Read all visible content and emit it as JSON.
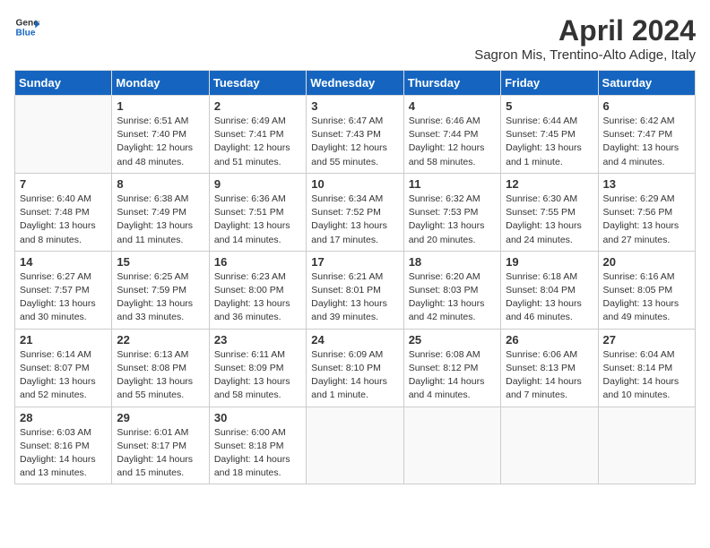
{
  "header": {
    "logo_line1": "General",
    "logo_line2": "Blue",
    "month_title": "April 2024",
    "subtitle": "Sagron Mis, Trentino-Alto Adige, Italy"
  },
  "days_of_week": [
    "Sunday",
    "Monday",
    "Tuesday",
    "Wednesday",
    "Thursday",
    "Friday",
    "Saturday"
  ],
  "weeks": [
    [
      {
        "day": "",
        "info": ""
      },
      {
        "day": "1",
        "info": "Sunrise: 6:51 AM\nSunset: 7:40 PM\nDaylight: 12 hours\nand 48 minutes."
      },
      {
        "day": "2",
        "info": "Sunrise: 6:49 AM\nSunset: 7:41 PM\nDaylight: 12 hours\nand 51 minutes."
      },
      {
        "day": "3",
        "info": "Sunrise: 6:47 AM\nSunset: 7:43 PM\nDaylight: 12 hours\nand 55 minutes."
      },
      {
        "day": "4",
        "info": "Sunrise: 6:46 AM\nSunset: 7:44 PM\nDaylight: 12 hours\nand 58 minutes."
      },
      {
        "day": "5",
        "info": "Sunrise: 6:44 AM\nSunset: 7:45 PM\nDaylight: 13 hours\nand 1 minute."
      },
      {
        "day": "6",
        "info": "Sunrise: 6:42 AM\nSunset: 7:47 PM\nDaylight: 13 hours\nand 4 minutes."
      }
    ],
    [
      {
        "day": "7",
        "info": "Sunrise: 6:40 AM\nSunset: 7:48 PM\nDaylight: 13 hours\nand 8 minutes."
      },
      {
        "day": "8",
        "info": "Sunrise: 6:38 AM\nSunset: 7:49 PM\nDaylight: 13 hours\nand 11 minutes."
      },
      {
        "day": "9",
        "info": "Sunrise: 6:36 AM\nSunset: 7:51 PM\nDaylight: 13 hours\nand 14 minutes."
      },
      {
        "day": "10",
        "info": "Sunrise: 6:34 AM\nSunset: 7:52 PM\nDaylight: 13 hours\nand 17 minutes."
      },
      {
        "day": "11",
        "info": "Sunrise: 6:32 AM\nSunset: 7:53 PM\nDaylight: 13 hours\nand 20 minutes."
      },
      {
        "day": "12",
        "info": "Sunrise: 6:30 AM\nSunset: 7:55 PM\nDaylight: 13 hours\nand 24 minutes."
      },
      {
        "day": "13",
        "info": "Sunrise: 6:29 AM\nSunset: 7:56 PM\nDaylight: 13 hours\nand 27 minutes."
      }
    ],
    [
      {
        "day": "14",
        "info": "Sunrise: 6:27 AM\nSunset: 7:57 PM\nDaylight: 13 hours\nand 30 minutes."
      },
      {
        "day": "15",
        "info": "Sunrise: 6:25 AM\nSunset: 7:59 PM\nDaylight: 13 hours\nand 33 minutes."
      },
      {
        "day": "16",
        "info": "Sunrise: 6:23 AM\nSunset: 8:00 PM\nDaylight: 13 hours\nand 36 minutes."
      },
      {
        "day": "17",
        "info": "Sunrise: 6:21 AM\nSunset: 8:01 PM\nDaylight: 13 hours\nand 39 minutes."
      },
      {
        "day": "18",
        "info": "Sunrise: 6:20 AM\nSunset: 8:03 PM\nDaylight: 13 hours\nand 42 minutes."
      },
      {
        "day": "19",
        "info": "Sunrise: 6:18 AM\nSunset: 8:04 PM\nDaylight: 13 hours\nand 46 minutes."
      },
      {
        "day": "20",
        "info": "Sunrise: 6:16 AM\nSunset: 8:05 PM\nDaylight: 13 hours\nand 49 minutes."
      }
    ],
    [
      {
        "day": "21",
        "info": "Sunrise: 6:14 AM\nSunset: 8:07 PM\nDaylight: 13 hours\nand 52 minutes."
      },
      {
        "day": "22",
        "info": "Sunrise: 6:13 AM\nSunset: 8:08 PM\nDaylight: 13 hours\nand 55 minutes."
      },
      {
        "day": "23",
        "info": "Sunrise: 6:11 AM\nSunset: 8:09 PM\nDaylight: 13 hours\nand 58 minutes."
      },
      {
        "day": "24",
        "info": "Sunrise: 6:09 AM\nSunset: 8:10 PM\nDaylight: 14 hours\nand 1 minute."
      },
      {
        "day": "25",
        "info": "Sunrise: 6:08 AM\nSunset: 8:12 PM\nDaylight: 14 hours\nand 4 minutes."
      },
      {
        "day": "26",
        "info": "Sunrise: 6:06 AM\nSunset: 8:13 PM\nDaylight: 14 hours\nand 7 minutes."
      },
      {
        "day": "27",
        "info": "Sunrise: 6:04 AM\nSunset: 8:14 PM\nDaylight: 14 hours\nand 10 minutes."
      }
    ],
    [
      {
        "day": "28",
        "info": "Sunrise: 6:03 AM\nSunset: 8:16 PM\nDaylight: 14 hours\nand 13 minutes."
      },
      {
        "day": "29",
        "info": "Sunrise: 6:01 AM\nSunset: 8:17 PM\nDaylight: 14 hours\nand 15 minutes."
      },
      {
        "day": "30",
        "info": "Sunrise: 6:00 AM\nSunset: 8:18 PM\nDaylight: 14 hours\nand 18 minutes."
      },
      {
        "day": "",
        "info": ""
      },
      {
        "day": "",
        "info": ""
      },
      {
        "day": "",
        "info": ""
      },
      {
        "day": "",
        "info": ""
      }
    ]
  ]
}
